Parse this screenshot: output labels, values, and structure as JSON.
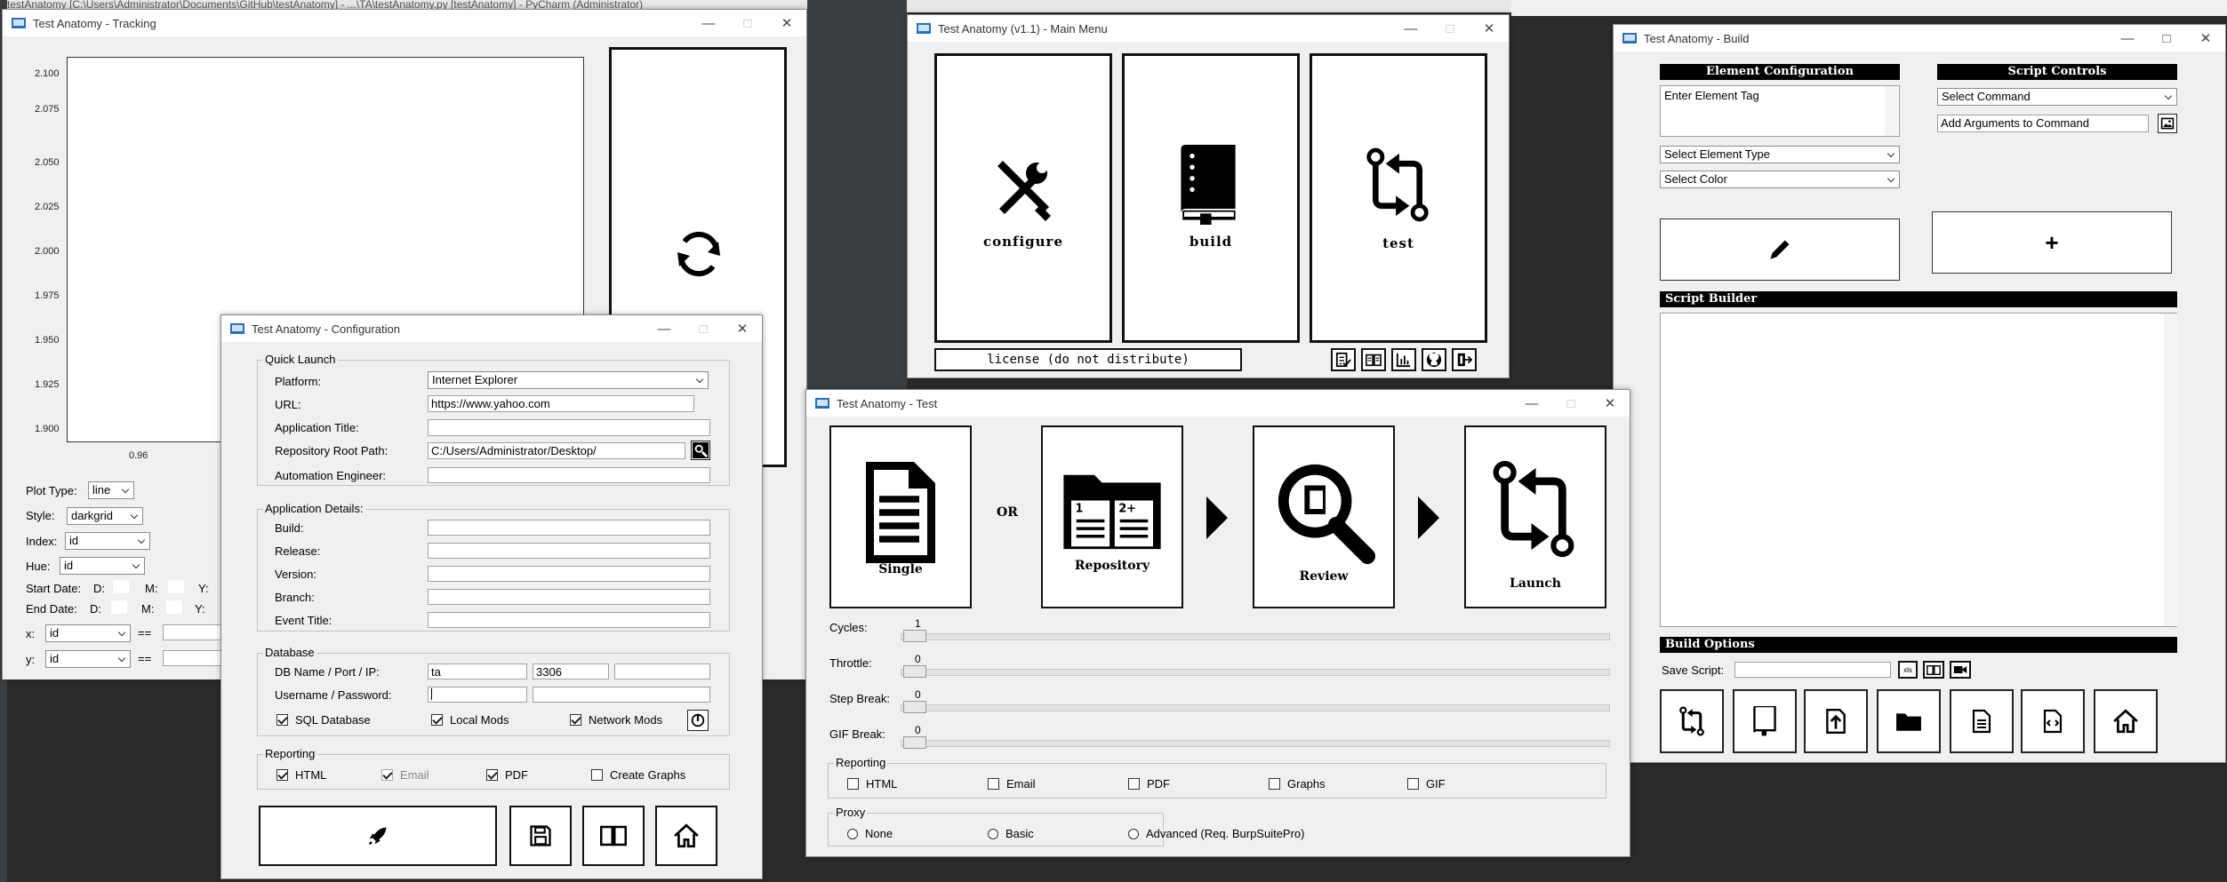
{
  "background_title": "testAnatomy [C:\\Users\\Administrator\\Documents\\GitHub\\testAnatomy] - ...\\TA\\testAnatomy.py [testAnatomy] - PyCharm (Administrator)",
  "tracking": {
    "title": "Test Anatomy - Tracking",
    "y_ticks": [
      "2.100",
      "2.075",
      "2.050",
      "2.025",
      "2.000",
      "1.975",
      "1.950",
      "1.925",
      "1.900"
    ],
    "x_tick": "0.96",
    "plot_type_label": "Plot Type:",
    "plot_type_value": "line",
    "style_label": "Style:",
    "style_value": "darkgrid",
    "index_label": "Index:",
    "index_value": "id",
    "hue_label": "Hue:",
    "hue_value": "id",
    "start_date_label": "Start Date:",
    "end_date_label": "End Date:",
    "d_label": "D:",
    "m_label": "M:",
    "y_label": "Y:",
    "x_label": "x:",
    "x_value": "id",
    "yy_label": "y:",
    "y_value": "id",
    "eq": "=="
  },
  "config": {
    "title": "Test Anatomy - Configuration",
    "quick_launch": "Quick Launch",
    "platform_label": "Platform:",
    "platform_value": "Internet Explorer",
    "url_label": "URL:",
    "url_value": "https://www.yahoo.com",
    "app_title_label": "Application Title:",
    "repo_label": "Repository Root Path:",
    "repo_value": "C:/Users/Administrator/Desktop/",
    "engineer_label": "Automation Engineer:",
    "app_details": "Application Details:",
    "build_label": "Build:",
    "release_label": "Release:",
    "version_label": "Version:",
    "branch_label": "Branch:",
    "event_label": "Event Title:",
    "database": "Database",
    "db_label": "DB Name / Port / IP:",
    "db_name": "ta",
    "db_port": "3306",
    "user_label": "Username / Password:",
    "sql_db": "SQL Database",
    "local_mods": "Local Mods",
    "network_mods": "Network Mods",
    "reporting": "Reporting",
    "html": "HTML",
    "email": "Email",
    "pdf": "PDF",
    "create_graphs": "Create Graphs"
  },
  "main_menu": {
    "title": "Test Anatomy (v1.1) - Main Menu",
    "configure": "configure",
    "build": "build",
    "test": "test",
    "license": "license (do not distribute)"
  },
  "test": {
    "title": "Test Anatomy - Test",
    "single": "Single",
    "or": "OR",
    "repository": "Repository",
    "review": "Review",
    "launch": "Launch",
    "cycles_label": "Cycles:",
    "cycles_value": "1",
    "throttle_label": "Throttle:",
    "throttle_value": "0",
    "step_label": "Step Break:",
    "step_value": "0",
    "gif_label": "GIF Break:",
    "gif_value": "0",
    "reporting": "Reporting",
    "html": "HTML",
    "email": "Email",
    "pdf": "PDF",
    "graphs": "Graphs",
    "gif": "GIF",
    "proxy": "Proxy",
    "none": "None",
    "basic": "Basic",
    "advanced": "Advanced (Req. BurpSuitePro)"
  },
  "build": {
    "title": "Test Anatomy - Build",
    "element_config": "Element Configuration",
    "script_controls": "Script Controls",
    "element_tag": "Enter Element Tag",
    "select_command": "Select Command",
    "add_args": "Add Arguments to Command",
    "select_element_type": "Select Element Type",
    "select_color": "Select Color",
    "plus": "+",
    "script_builder": "Script Builder",
    "build_options": "Build Options",
    "save_script_label": "Save Script:"
  }
}
